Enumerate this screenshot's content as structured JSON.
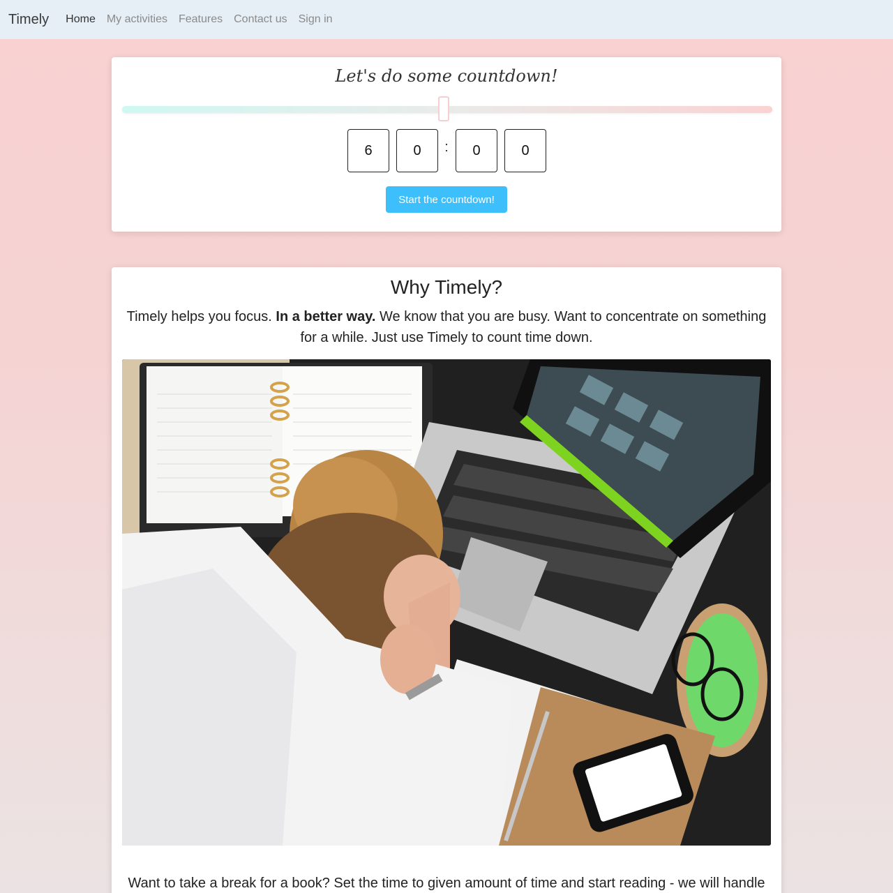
{
  "nav": {
    "brand": "Timely",
    "links": [
      "Home",
      "My activities",
      "Features",
      "Contact us",
      "Sign in"
    ],
    "active": "Home"
  },
  "countdown": {
    "title": "Let's do some countdown!",
    "slider_value_fraction": 0.5,
    "digits": [
      "6",
      "0",
      "0",
      "0"
    ],
    "separator": ":",
    "start_label": "Start the countdown!"
  },
  "why": {
    "heading": "Why Timely?",
    "intro_start": "Timely helps you focus. ",
    "intro_bold": "In a better way.",
    "intro_end": " We know that you are busy. Want to concentrate on something for a while. Just use Timely to count time down.",
    "photo": "illustration of a tired woman resting her head over a desk with a planner, laptop, glasses and phone",
    "break_text": "Want to take a break for a book? Set the time to given amount of time and start reading - we will handle"
  },
  "colors": {
    "navbar_bg": "#e6eff6",
    "button_bg": "#3cbffa",
    "page_bg_top": "#f9d1d1",
    "page_bg_bottom": "#ebe3e3"
  }
}
